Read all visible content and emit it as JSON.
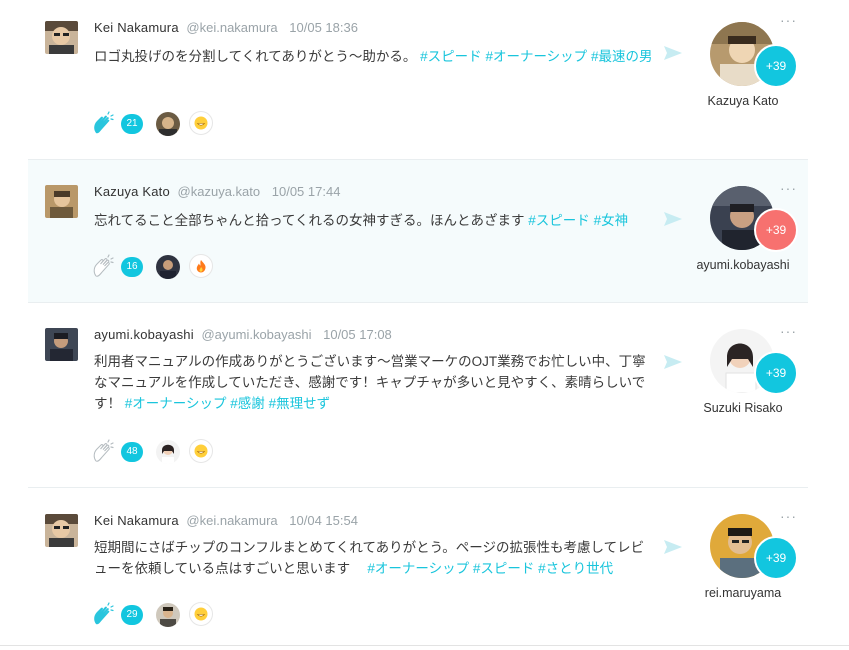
{
  "colors": {
    "accent": "#12c6df",
    "tag": "#1ac5dc",
    "badge_red": "#f7716f",
    "muted": "#9aa3a8"
  },
  "posts": [
    {
      "author": "Kei Nakamura",
      "handle": "@kei.nakamura",
      "time": "10/05 18:36",
      "text": "ロゴ丸投げのを分割してくれてありがとう〜助かる。",
      "tags": [
        "#スピード",
        "#オーナーシップ",
        "#最速の男"
      ],
      "clap_count": "21",
      "clap_icon": "clap-icon",
      "reaction_emoji": "grin-emoji",
      "recipient_name": "Kazuya Kato",
      "plus_count": "+39",
      "badge_color": "#12c6df",
      "more": "···"
    },
    {
      "author": "Kazuya Kato",
      "handle": "@kazuya.kato",
      "time": "10/05 17:44",
      "text": "忘れてること全部ちゃんと拾ってくれるの女神すぎる。ほんとあざます",
      "tags": [
        "#スピード",
        "#女神"
      ],
      "clap_count": "16",
      "clap_icon": "clap-outline-icon",
      "reaction_emoji": "fire-emoji",
      "recipient_name": "ayumi.kobayashi",
      "plus_count": "+39",
      "badge_color": "#f7716f",
      "more": "···"
    },
    {
      "author": "ayumi.kobayashi",
      "handle": "@ayumi.kobayashi",
      "time": "10/05 17:08",
      "text": "利用者マニュアルの作成ありがとうございます〜営業マーケのOJT業務でお忙しい中、丁寧なマニュアルを作成していただき、感謝です！キャプチャが多いと見やすく、素晴らしいです！",
      "tags": [
        "#オーナーシップ",
        "#感謝",
        "#無理せず"
      ],
      "clap_count": "48",
      "clap_icon": "clap-outline-icon",
      "reaction_emoji": "grin-emoji",
      "recipient_name": "Suzuki Risako",
      "plus_count": "+39",
      "badge_color": "#12c6df",
      "more": "···"
    },
    {
      "author": "Kei Nakamura",
      "handle": "@kei.nakamura",
      "time": "10/04 15:54",
      "text": "短期間にさばチップのコンフルまとめてくれてありがとう。ページの拡張性も考慮してレビューを依頼している点はすごいと思います　",
      "tags": [
        "#オーナーシップ",
        "#スピード",
        "#さとり世代"
      ],
      "clap_count": "29",
      "clap_icon": "clap-icon",
      "reaction_emoji": "grin-emoji",
      "recipient_name": "rei.maruyama",
      "plus_count": "+39",
      "badge_color": "#12c6df",
      "more": "···"
    }
  ]
}
